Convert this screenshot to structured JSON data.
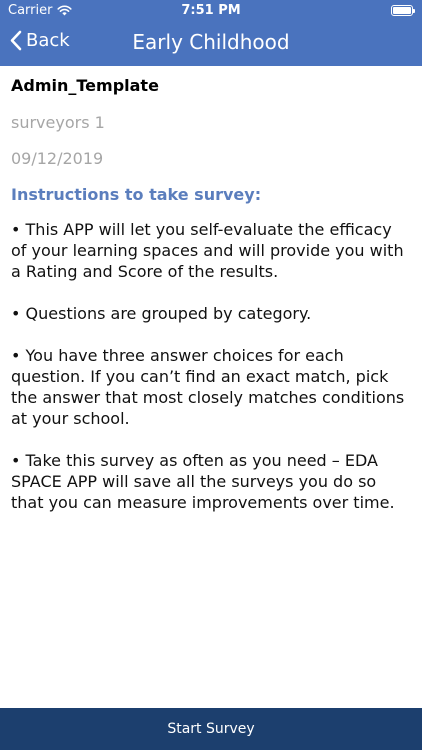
{
  "status_bar": {
    "carrier": "Carrier",
    "time": "7:51 PM",
    "wifi_icon": "wifi-icon",
    "battery_icon": "battery-icon"
  },
  "nav": {
    "back_label": "Back",
    "back_icon": "chevron-left-icon",
    "title": "Early Childhood"
  },
  "survey": {
    "template_name": "Admin_Template",
    "surveyors": "surveyors 1",
    "date": "09/12/2019",
    "instructions_heading": "Instructions to take survey:",
    "instructions": [
      "• This APP will let you self-evaluate the efficacy of your learning spaces and will provide you with a Rating and Score of the results.",
      "• Questions are grouped by category.",
      "• You have three answer choices for each question. If you can’t find an exact match, pick the answer that most closely matches conditions at your school.",
      "• Take this survey as often as you need – EDA SPACE APP will save all the surveys you do so that you can measure improvements over time."
    ]
  },
  "footer": {
    "start_label": "Start Survey"
  },
  "colors": {
    "header_bg": "#4a73be",
    "heading_color": "#5b7ebd",
    "footer_bg": "#1c3f6e",
    "meta_text": "#a6a6a6"
  }
}
